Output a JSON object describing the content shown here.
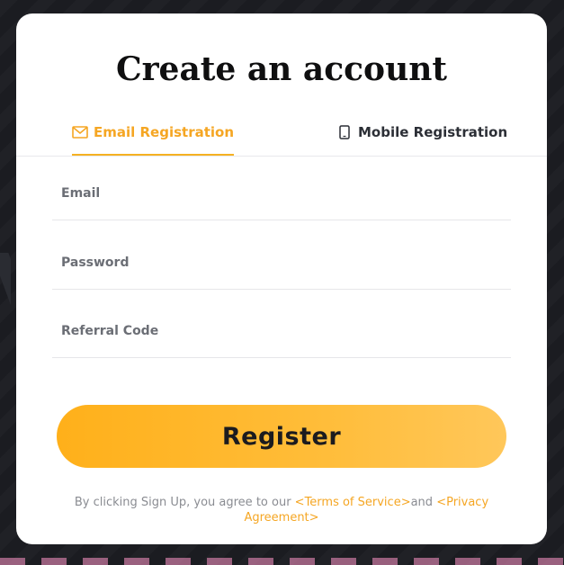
{
  "page": {
    "title": "Create an account"
  },
  "tabs": [
    {
      "label": "Email Registration",
      "icon": "mail-icon",
      "active": true
    },
    {
      "label": "Mobile Registration",
      "icon": "mobile-phone-icon",
      "active": false
    }
  ],
  "form": {
    "email": {
      "placeholder": "Email",
      "value": ""
    },
    "password": {
      "placeholder": "Password",
      "value": ""
    },
    "referral": {
      "placeholder": "Referral Code",
      "value": ""
    }
  },
  "register_button": {
    "label": "Register"
  },
  "terms": {
    "prefix": "By clicking Sign Up, you agree to our ",
    "terms_link": "<Terms of Service>",
    "connector": "and ",
    "privacy_link": "<Privacy Agreement>"
  },
  "colors": {
    "accent": "#f5a623",
    "button_gradient_start": "#ffb01a",
    "button_gradient_end": "#ffc75a",
    "page_background": "#1b1c21",
    "card_background": "#ffffff"
  }
}
